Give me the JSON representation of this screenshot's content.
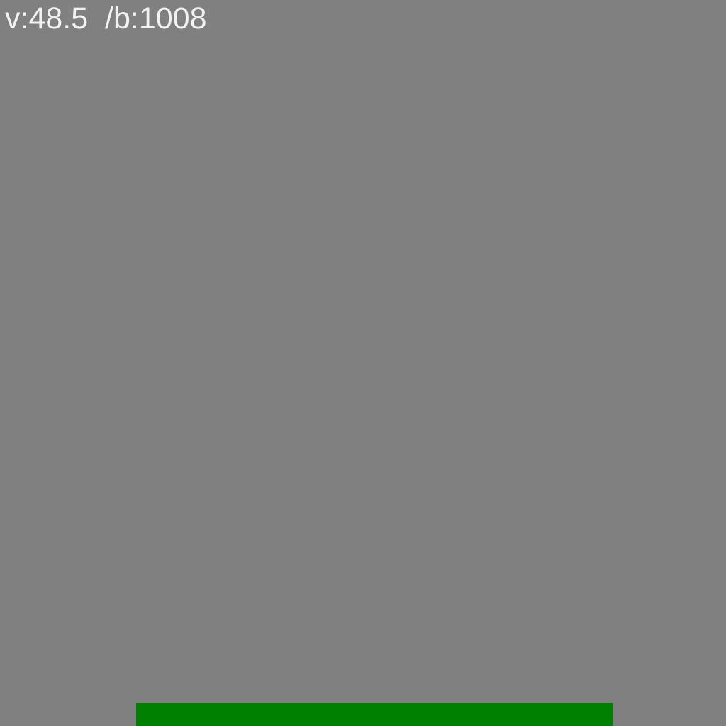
{
  "hud": {
    "velocity_label": "v:48.5",
    "separator": "  ",
    "bounce_label": "/b:1008"
  },
  "colors": {
    "background": "#808080",
    "paddle": "#008000",
    "text": "#f2f2f2"
  }
}
